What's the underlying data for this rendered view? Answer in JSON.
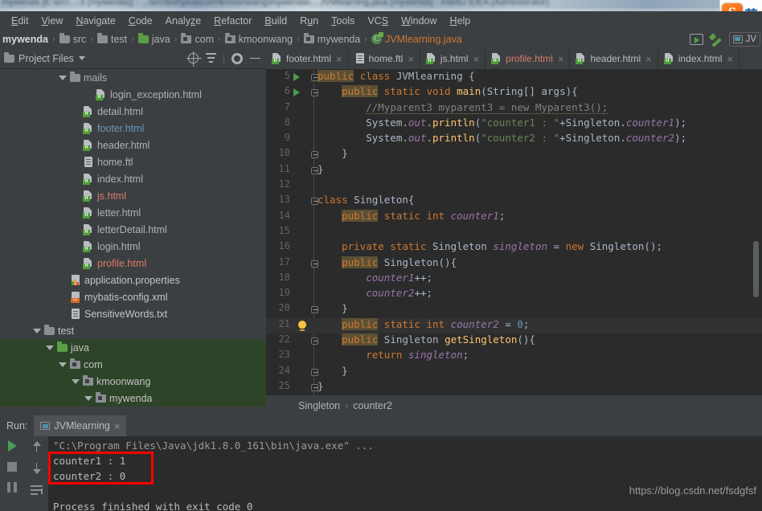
{
  "window": {
    "title_blurred": "mywenda [E:\\src\\...-3 (mywenda)] - ...\\src\\test\\java\\com\\kmoonwang\\mywenda\\...  JVMlearning.java [mywenda] - IntelliJ IDEA (Administrator)",
    "ime": {
      "logo": "S",
      "mode_label": "英"
    }
  },
  "menubar": {
    "items": [
      {
        "label": "Edit",
        "mnemonic": "E"
      },
      {
        "label": "View",
        "mnemonic": "V"
      },
      {
        "label": "Navigate",
        "mnemonic": "N"
      },
      {
        "label": "Code",
        "mnemonic": "C"
      },
      {
        "label": "Analyze",
        "mnemonic": "z"
      },
      {
        "label": "Refactor",
        "mnemonic": "R"
      },
      {
        "label": "Build",
        "mnemonic": "B"
      },
      {
        "label": "Run",
        "mnemonic": "u"
      },
      {
        "label": "Tools",
        "mnemonic": "T"
      },
      {
        "label": "VCS",
        "mnemonic": "S"
      },
      {
        "label": "Window",
        "mnemonic": "W"
      },
      {
        "label": "Help",
        "mnemonic": "H"
      }
    ]
  },
  "navbar": {
    "crumbs": [
      {
        "label": "mywenda",
        "icon": "none",
        "kind": "project"
      },
      {
        "label": "src",
        "icon": "folder-icon",
        "kind": "folder"
      },
      {
        "label": "test",
        "icon": "folder-icon",
        "kind": "folder"
      },
      {
        "label": "java",
        "icon": "source-folder-icon",
        "kind": "source-folder"
      },
      {
        "label": "com",
        "icon": "package-icon",
        "kind": "package"
      },
      {
        "label": "kmoonwang",
        "icon": "package-icon",
        "kind": "package"
      },
      {
        "label": "mywenda",
        "icon": "package-icon",
        "kind": "package"
      },
      {
        "label": "JVMlearning.java",
        "icon": "java-class-icon",
        "kind": "file"
      }
    ],
    "separator": "›",
    "run_config_label": "JV"
  },
  "project_panel": {
    "title": "Project Files",
    "toolbar": [
      "locate-icon",
      "collapse-all-icon",
      "settings-gear-icon",
      "minimize-icon"
    ],
    "tree": [
      {
        "label": "mails",
        "indent": 4,
        "icon": "folder-icon",
        "color": "default",
        "expanded": true,
        "selected": false
      },
      {
        "label": "login_exception.html",
        "indent": 6,
        "icon": "html-file-icon",
        "color": "default",
        "selected": false
      },
      {
        "label": "detail.html",
        "indent": 5,
        "icon": "html-file-icon",
        "color": "default",
        "selected": false
      },
      {
        "label": "footer.html",
        "indent": 5,
        "icon": "html-file-icon",
        "color": "blue",
        "selected": false
      },
      {
        "label": "header.html",
        "indent": 5,
        "icon": "html-file-icon",
        "color": "default",
        "selected": false
      },
      {
        "label": "home.ftl",
        "indent": 5,
        "icon": "text-file-icon",
        "color": "default",
        "selected": false
      },
      {
        "label": "index.html",
        "indent": 5,
        "icon": "html-file-icon",
        "color": "default",
        "selected": false
      },
      {
        "label": "js.html",
        "indent": 5,
        "icon": "html-file-icon",
        "color": "salmon",
        "selected": false
      },
      {
        "label": "letter.html",
        "indent": 5,
        "icon": "html-file-icon",
        "color": "default",
        "selected": false
      },
      {
        "label": "letterDetail.html",
        "indent": 5,
        "icon": "html-file-icon",
        "color": "default",
        "selected": false
      },
      {
        "label": "login.html",
        "indent": 5,
        "icon": "html-file-icon",
        "color": "default",
        "selected": false
      },
      {
        "label": "profile.html",
        "indent": 5,
        "icon": "html-file-icon",
        "color": "salmon",
        "selected": false
      },
      {
        "label": "application.properties",
        "indent": 4,
        "icon": "properties-file-icon",
        "color": "white",
        "selected": false
      },
      {
        "label": "mybatis-config.xml",
        "indent": 4,
        "icon": "xml-file-icon",
        "color": "white",
        "selected": false
      },
      {
        "label": "SensitiveWords.txt",
        "indent": 4,
        "icon": "text-file-icon",
        "color": "white",
        "selected": false
      },
      {
        "label": "test",
        "indent": 2,
        "icon": "folder-icon",
        "color": "white",
        "expanded": true,
        "selected": false
      },
      {
        "label": "java",
        "indent": 3,
        "icon": "source-folder-icon",
        "color": "white",
        "expanded": true,
        "selected": true
      },
      {
        "label": "com",
        "indent": 4,
        "icon": "package-icon",
        "color": "white",
        "expanded": true,
        "selected": true
      },
      {
        "label": "kmoonwang",
        "indent": 5,
        "icon": "package-icon",
        "color": "white",
        "expanded": true,
        "selected": true
      },
      {
        "label": "mywenda",
        "indent": 6,
        "icon": "package-icon",
        "color": "white",
        "expanded": true,
        "selected": true
      }
    ]
  },
  "editor": {
    "tabs": [
      {
        "label": "footer.html",
        "icon": "html-file-icon",
        "color": "default",
        "close": "×"
      },
      {
        "label": "home.ftl",
        "icon": "text-file-icon",
        "color": "default",
        "close": "×"
      },
      {
        "label": "js.html",
        "icon": "html-file-icon",
        "color": "default",
        "close": "×"
      },
      {
        "label": "profile.html",
        "icon": "html-file-icon",
        "color": "salmon",
        "close": "×"
      },
      {
        "label": "header.html",
        "icon": "html-file-icon",
        "color": "default",
        "close": "×"
      },
      {
        "label": "index.html",
        "icon": "html-file-icon",
        "color": "default",
        "close": "×"
      }
    ],
    "first_line_number": 5,
    "lines": [
      {
        "n": 5,
        "text": "public class JVMlearning {",
        "gutter": "run",
        "fold": true,
        "current": false
      },
      {
        "n": 6,
        "text": "    public static void main(String[] args){",
        "gutter": "run",
        "fold": true,
        "current": false
      },
      {
        "n": 7,
        "text": "        //Myparent3 myparent3 = new Myparent3();",
        "gutter": "",
        "fold": false,
        "current": false
      },
      {
        "n": 8,
        "text": "        System.out.println(\"counter1 : \"+Singleton.counter1);",
        "gutter": "",
        "fold": false,
        "current": false
      },
      {
        "n": 9,
        "text": "        System.out.println(\"counter2 : \"+Singleton.counter2);",
        "gutter": "",
        "fold": false,
        "current": false
      },
      {
        "n": 10,
        "text": "    }",
        "gutter": "",
        "fold": true,
        "current": false
      },
      {
        "n": 11,
        "text": "}",
        "gutter": "",
        "fold": true,
        "current": false
      },
      {
        "n": 12,
        "text": "",
        "gutter": "",
        "fold": false,
        "current": false
      },
      {
        "n": 13,
        "text": "class Singleton{",
        "gutter": "",
        "fold": true,
        "current": false
      },
      {
        "n": 14,
        "text": "    public static int counter1;",
        "gutter": "",
        "fold": false,
        "current": false
      },
      {
        "n": 15,
        "text": "",
        "gutter": "",
        "fold": false,
        "current": false
      },
      {
        "n": 16,
        "text": "    private static Singleton singleton = new Singleton();",
        "gutter": "",
        "fold": false,
        "current": false
      },
      {
        "n": 17,
        "text": "    public Singleton(){",
        "gutter": "",
        "fold": true,
        "current": false
      },
      {
        "n": 18,
        "text": "        counter1++;",
        "gutter": "",
        "fold": false,
        "current": false
      },
      {
        "n": 19,
        "text": "        counter2++;",
        "gutter": "",
        "fold": false,
        "current": false
      },
      {
        "n": 20,
        "text": "    }",
        "gutter": "",
        "fold": true,
        "current": false
      },
      {
        "n": 21,
        "text": "    public static int counter2 = 0;",
        "gutter": "bulb",
        "fold": false,
        "current": true
      },
      {
        "n": 22,
        "text": "    public Singleton getSingleton(){",
        "gutter": "",
        "fold": true,
        "current": false
      },
      {
        "n": 23,
        "text": "        return singleton;",
        "gutter": "",
        "fold": false,
        "current": false
      },
      {
        "n": 24,
        "text": "    }",
        "gutter": "",
        "fold": true,
        "current": false
      },
      {
        "n": 25,
        "text": "}",
        "gutter": "",
        "fold": true,
        "current": false
      }
    ],
    "breadcrumb": {
      "items": [
        "Singleton",
        "counter2"
      ],
      "separator": "›"
    }
  },
  "run_window": {
    "label": "Run:",
    "tab_label": "JVMlearning",
    "tab_close": "×",
    "toolbar": [
      "run-icon",
      "stop-icon",
      "pause-icon",
      "scroll-up-icon",
      "scroll-down-icon",
      "soft-wrap-icon"
    ],
    "console_lines": [
      {
        "text": "\"C:\\Program Files\\Java\\jdk1.8.0_161\\bin\\java.exe\" ...",
        "dim": true
      },
      {
        "text": "counter1 : 1",
        "dim": false
      },
      {
        "text": "counter2 : 0",
        "dim": false
      },
      {
        "text": "",
        "dim": false
      },
      {
        "text": "Process finished with exit code 0",
        "dim": false
      }
    ],
    "annotation_color": "#ff0000"
  },
  "watermark": {
    "text": "https://blog.csdn.net/fsdgfsf"
  },
  "colors": {
    "panel_bg": "#3c3f41",
    "editor_bg": "#2b2b2b",
    "selection_green": "#2d4428",
    "keyword_orange": "#cc7832",
    "string_green": "#6a8759",
    "number_blue": "#6897bb",
    "field_purple": "#9876aa",
    "method_yellow": "#ffc66d",
    "comment_gray": "#808080",
    "annotation_red": "#ff0000"
  }
}
